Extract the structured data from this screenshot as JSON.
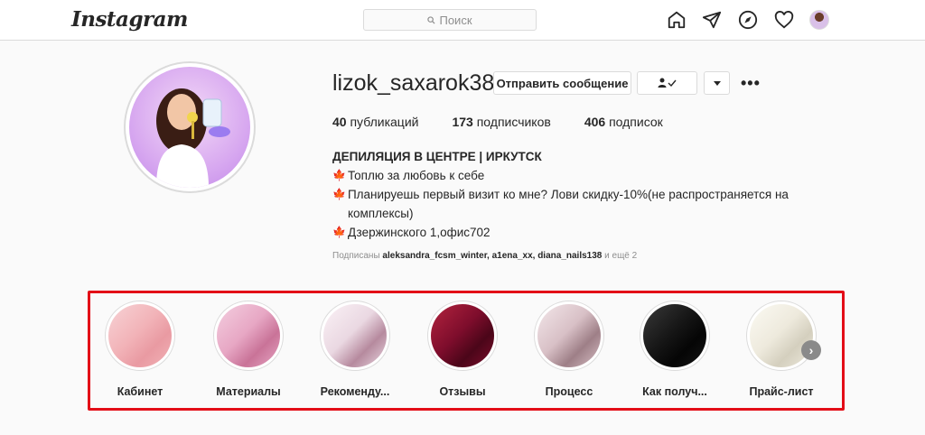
{
  "header": {
    "logo": "Instagram",
    "search_placeholder": "Поиск",
    "nav_icons": [
      "home-icon",
      "direct-icon",
      "explore-icon",
      "activity-icon",
      "profile-avatar"
    ]
  },
  "profile": {
    "username": "lizok_saxarok38",
    "buttons": {
      "message": "Отправить сообщение"
    },
    "stats": [
      {
        "count": "40",
        "label": "публикаций"
      },
      {
        "count": "173",
        "label": "подписчиков"
      },
      {
        "count": "406",
        "label": "подписок"
      }
    ],
    "bio": {
      "title": "ДЕПИЛЯЦИЯ В ЦЕНТРЕ | ИРКУТСК",
      "lines": [
        "Топлю за любовь к себе",
        "Планируешь первый визит ко мне? Лови скидку-10%(не распространяется на комплексы)",
        "Дзержинского 1,офис702"
      ]
    },
    "followed_by": {
      "prefix": "Подписаны",
      "names": "aleksandra_fcsm_winter, a1ena_xx, diana_nails138",
      "suffix": "и ещё 2"
    }
  },
  "highlights": [
    {
      "label": "Кабинет",
      "color": "#f2b3b8"
    },
    {
      "label": "Материалы",
      "color": "#e7a7c4"
    },
    {
      "label": "Рекоменду...",
      "color": "#ead8e2"
    },
    {
      "label": "Отзывы",
      "color": "#7e0d2c"
    },
    {
      "label": "Процесс",
      "color": "#d8c0c6"
    },
    {
      "label": "Как получ...",
      "color": "#161616"
    },
    {
      "label": "Прайс-лист",
      "color": "#eeeadd"
    }
  ],
  "colors": {
    "highlight_frame": "#e30d17",
    "border": "#dbdbdb"
  }
}
